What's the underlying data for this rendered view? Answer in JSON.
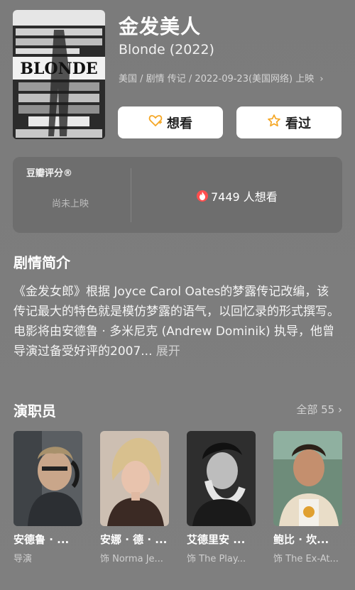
{
  "movie": {
    "title": "金发美人",
    "original_title": "Blonde (2022)",
    "meta": "美国 / 剧情 传记 / 2022-09-23(美国网络) 上映",
    "poster_text": "BLONDE"
  },
  "actions": {
    "want_label": "想看",
    "seen_label": "看过"
  },
  "rating": {
    "label": "豆瓣评分®",
    "status": "尚未上映",
    "want_count": "7449 人想看"
  },
  "synopsis": {
    "title": "剧情简介",
    "text": "《金发女郎》根据 Joyce Carol Oates的梦露传记改编，该传记最大的特色就是模仿梦露的语气，以回忆录的形式撰写。电影将由安德鲁 · 多米尼克 (Andrew Dominik) 执导，他曾导演过备受好评的2007...",
    "expand_label": "展开"
  },
  "cast": {
    "title": "演职员",
    "all_label": "全部 55",
    "members": [
      {
        "name": "安德鲁 · ...",
        "role": "导演"
      },
      {
        "name": "安娜 · 德 · ...",
        "role": "饰 Norma Je..."
      },
      {
        "name": "艾德里安 ...",
        "role": "饰 The Play..."
      },
      {
        "name": "鲍比 · 坎...",
        "role": "饰 The Ex-At..."
      }
    ]
  },
  "colors": {
    "background": "#7d7d7d",
    "card": "#6e6e6e",
    "accent_fire": "#ff4e4e",
    "star": "#f5a623"
  }
}
